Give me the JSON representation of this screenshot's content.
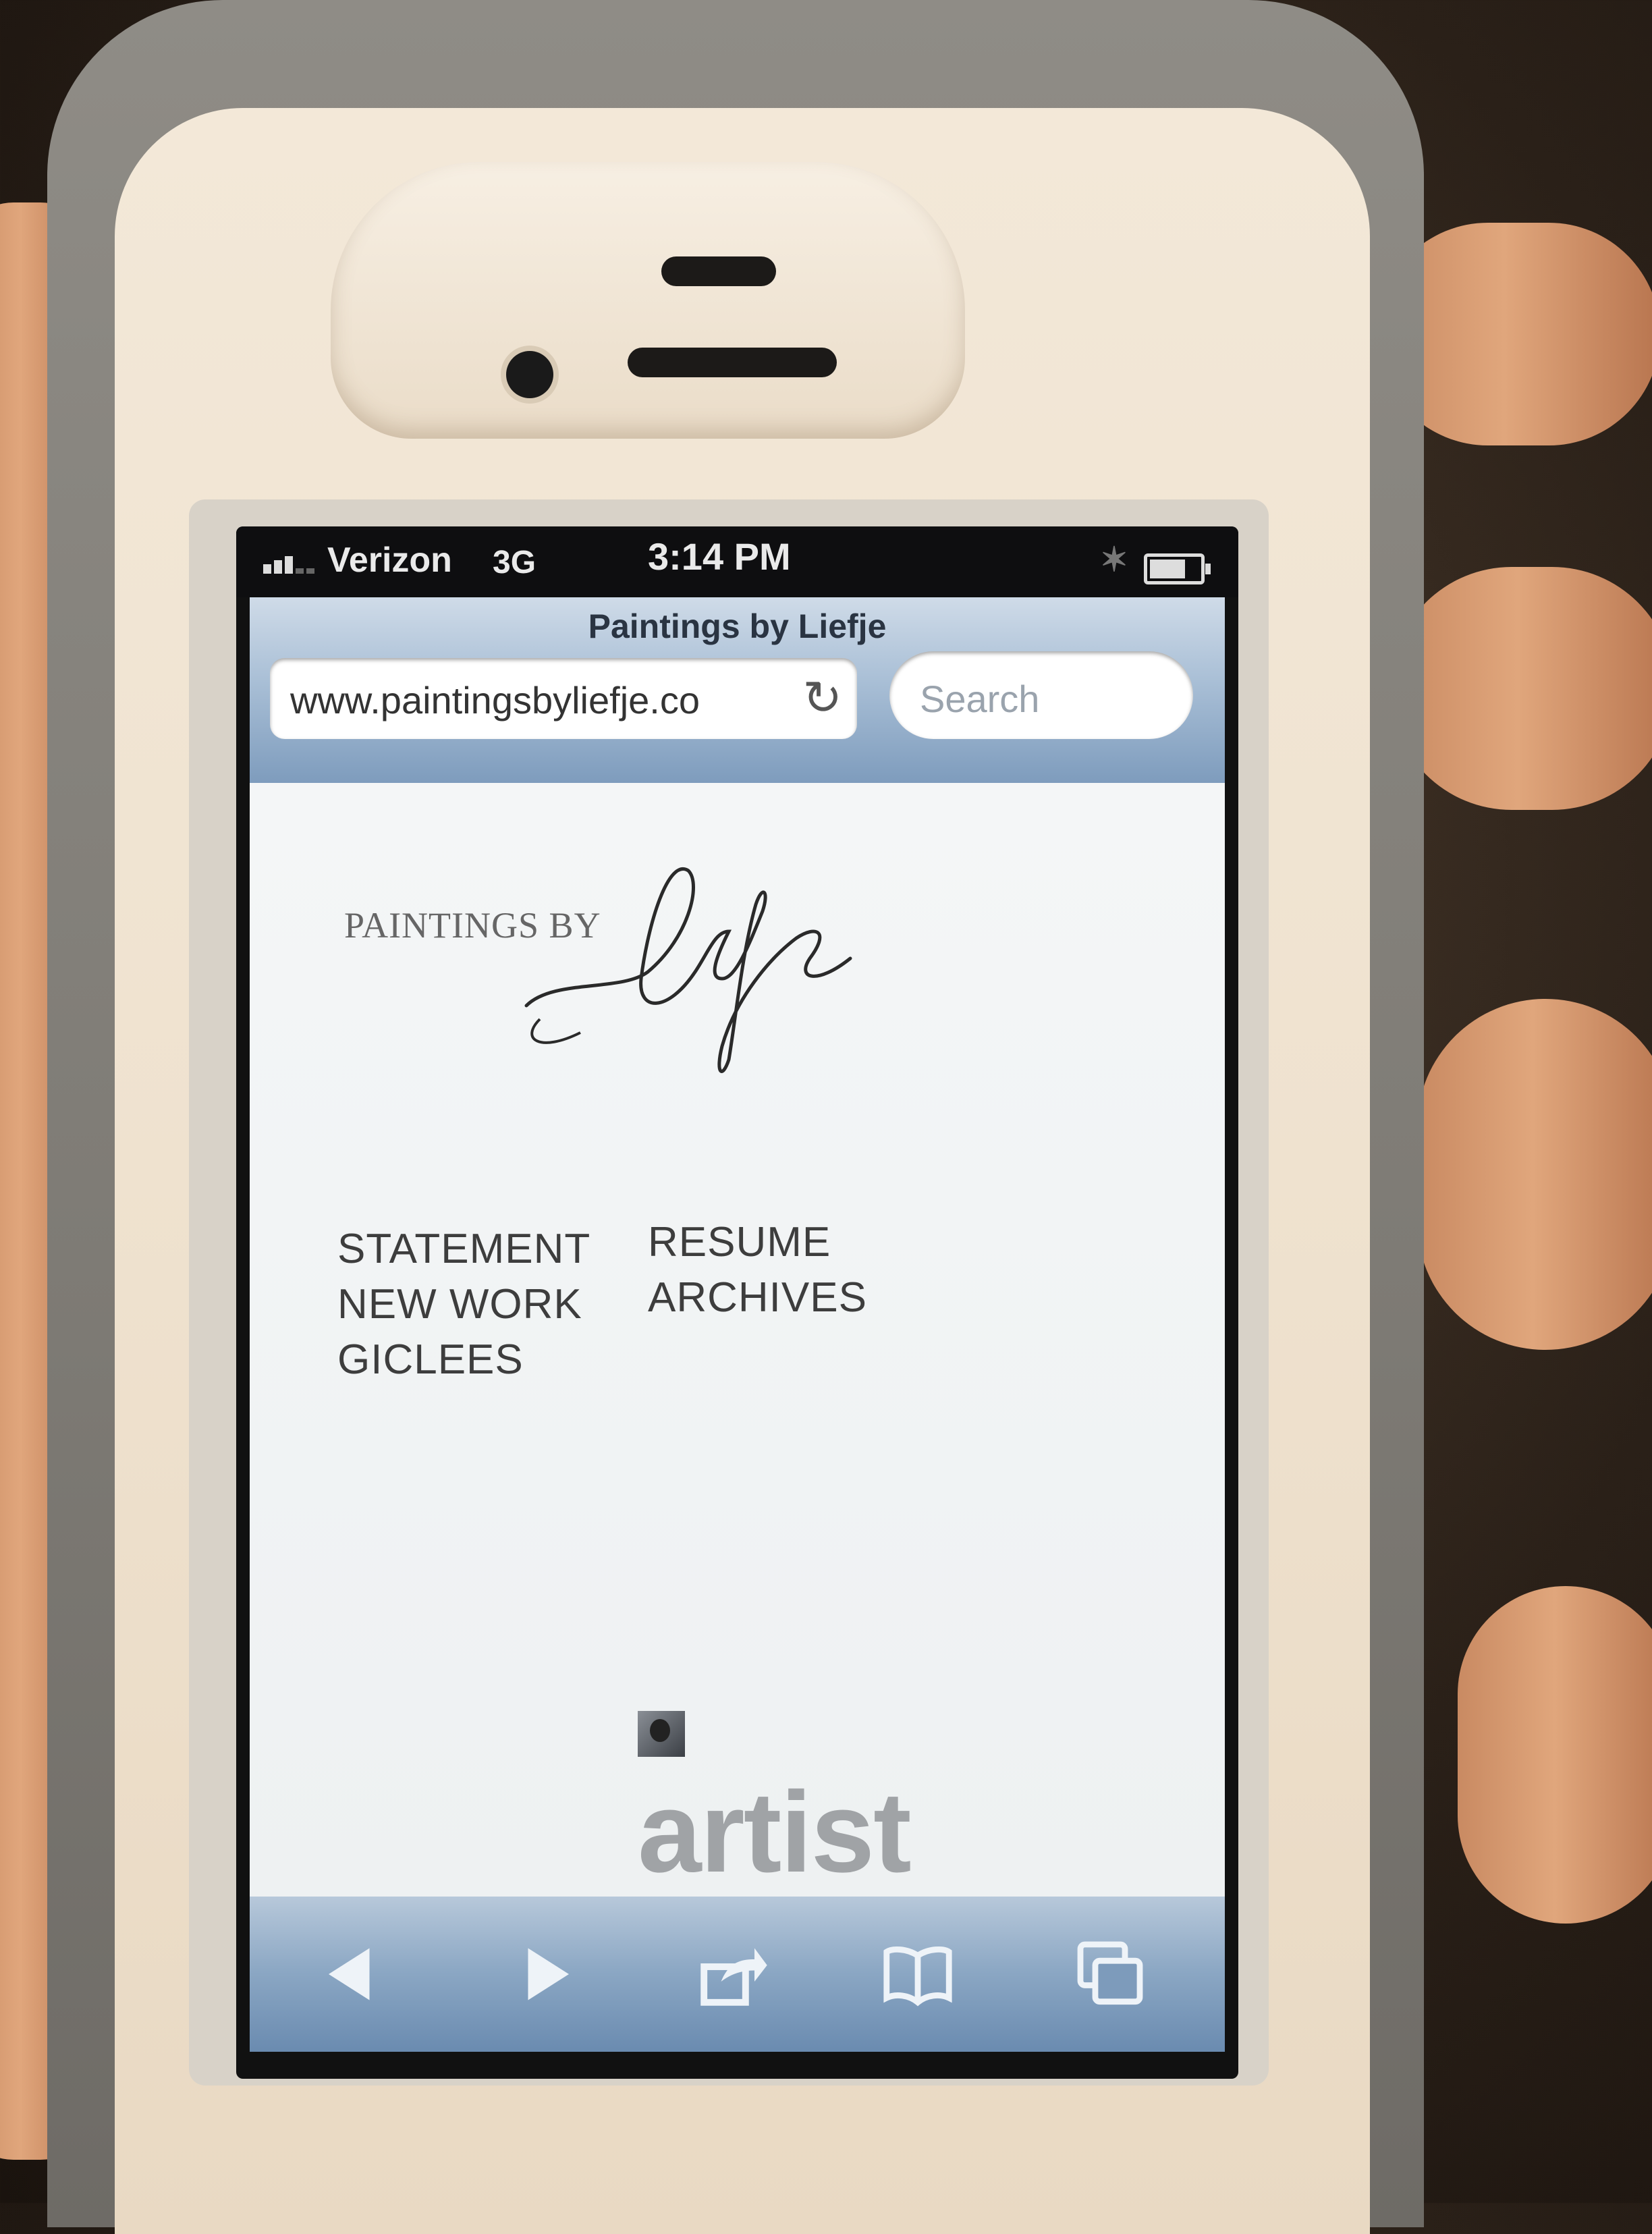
{
  "status_bar": {
    "carrier": "Verizon",
    "network": "3G",
    "time": "3:14 PM"
  },
  "browser": {
    "page_title": "Paintings by Liefje",
    "url": "www.paintingsbyliefje.co",
    "search_placeholder": "Search"
  },
  "page": {
    "logo_text": "PAINTINGS BY",
    "logo_signature": "Liefje",
    "menu_left": [
      "STATEMENT",
      "NEW WORK",
      "GICLEES"
    ],
    "menu_right": [
      "RESUME",
      "ARCHIVES"
    ],
    "artist_text": "artist"
  },
  "toolbar": {
    "icons": [
      "back-icon",
      "forward-icon",
      "share-icon",
      "bookmarks-icon",
      "tabs-icon"
    ]
  },
  "colors": {
    "navbar_blue": "#a9bfd6",
    "page_bg": "#f4f6f7",
    "case_grey": "#7d7a74",
    "bezel_cream": "#efe2cf"
  }
}
